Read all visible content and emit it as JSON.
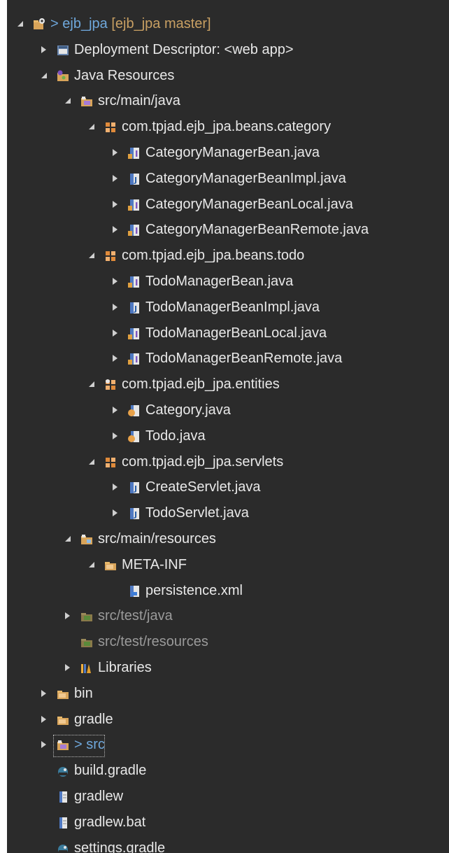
{
  "colors": {
    "background": "#2b2b2b",
    "text": "#e8e8e8",
    "muted_text": "#9a9a9a",
    "decoration": "#c9a063",
    "link": "#6fa8dc"
  },
  "tree": [
    {
      "id": "r0",
      "depth": 0,
      "state": "expanded",
      "icon": "project-icon",
      "prefix": "> ",
      "label": "ejb_jpa",
      "decoration": " [ejb_jpa master]",
      "style": "link"
    },
    {
      "id": "r1",
      "depth": 1,
      "state": "collapsed",
      "icon": "deployment-descriptor-icon",
      "label": "Deployment Descriptor: <web app>"
    },
    {
      "id": "r2",
      "depth": 1,
      "state": "expanded",
      "icon": "java-resources-icon",
      "label": "Java Resources"
    },
    {
      "id": "r3",
      "depth": 2,
      "state": "expanded",
      "icon": "source-folder-icon",
      "label": "src/main/java"
    },
    {
      "id": "r4",
      "depth": 3,
      "state": "expanded",
      "icon": "package-icon",
      "label": "com.tpjad.ejb_jpa.beans.category"
    },
    {
      "id": "r5",
      "depth": 4,
      "state": "collapsed",
      "icon": "java-interface-icon",
      "label": "CategoryManagerBean.java"
    },
    {
      "id": "r6",
      "depth": 4,
      "state": "collapsed",
      "icon": "java-class-icon",
      "label": "CategoryManagerBeanImpl.java"
    },
    {
      "id": "r7",
      "depth": 4,
      "state": "collapsed",
      "icon": "java-interface-icon",
      "label": "CategoryManagerBeanLocal.java"
    },
    {
      "id": "r8",
      "depth": 4,
      "state": "collapsed",
      "icon": "java-interface-icon",
      "label": "CategoryManagerBeanRemote.java"
    },
    {
      "id": "r9",
      "depth": 3,
      "state": "expanded",
      "icon": "package-icon",
      "label": "com.tpjad.ejb_jpa.beans.todo"
    },
    {
      "id": "r10",
      "depth": 4,
      "state": "collapsed",
      "icon": "java-interface-icon",
      "label": "TodoManagerBean.java"
    },
    {
      "id": "r11",
      "depth": 4,
      "state": "collapsed",
      "icon": "java-class-icon",
      "label": "TodoManagerBeanImpl.java"
    },
    {
      "id": "r12",
      "depth": 4,
      "state": "collapsed",
      "icon": "java-interface-icon",
      "label": "TodoManagerBeanLocal.java"
    },
    {
      "id": "r13",
      "depth": 4,
      "state": "collapsed",
      "icon": "java-interface-icon",
      "label": "TodoManagerBeanRemote.java"
    },
    {
      "id": "r14",
      "depth": 3,
      "state": "expanded",
      "icon": "entity-package-icon",
      "label": "com.tpjad.ejb_jpa.entities"
    },
    {
      "id": "r15",
      "depth": 4,
      "state": "collapsed",
      "icon": "entity-class-icon",
      "label": "Category.java"
    },
    {
      "id": "r16",
      "depth": 4,
      "state": "collapsed",
      "icon": "entity-class-icon",
      "label": "Todo.java"
    },
    {
      "id": "r17",
      "depth": 3,
      "state": "expanded",
      "icon": "package-icon",
      "label": "com.tpjad.ejb_jpa.servlets"
    },
    {
      "id": "r18",
      "depth": 4,
      "state": "collapsed",
      "icon": "java-class-icon",
      "label": "CreateServlet.java"
    },
    {
      "id": "r19",
      "depth": 4,
      "state": "collapsed",
      "icon": "java-class-icon",
      "label": "TodoServlet.java"
    },
    {
      "id": "r20",
      "depth": 2,
      "state": "expanded",
      "icon": "resource-folder-icon",
      "label": "src/main/resources"
    },
    {
      "id": "r21",
      "depth": 3,
      "state": "expanded",
      "icon": "folder-icon",
      "label": "META-INF"
    },
    {
      "id": "r22",
      "depth": 4,
      "state": "leaf",
      "icon": "xml-file-icon",
      "label": "persistence.xml"
    },
    {
      "id": "r23",
      "depth": 2,
      "state": "collapsed",
      "icon": "test-folder-icon",
      "label": "src/test/java",
      "style": "muted"
    },
    {
      "id": "r24",
      "depth": 2,
      "state": "leaf",
      "icon": "test-folder-icon",
      "label": "src/test/resources",
      "style": "muted"
    },
    {
      "id": "r25",
      "depth": 2,
      "state": "collapsed",
      "icon": "libraries-icon",
      "label": "Libraries"
    },
    {
      "id": "r26",
      "depth": 1,
      "state": "collapsed",
      "icon": "folder-icon",
      "label": "bin"
    },
    {
      "id": "r27",
      "depth": 1,
      "state": "collapsed",
      "icon": "folder-icon",
      "label": "gradle"
    },
    {
      "id": "r28",
      "depth": 1,
      "state": "collapsed",
      "icon": "source-folder-icon",
      "prefix": "> ",
      "label": "src",
      "style": "link",
      "selected": true
    },
    {
      "id": "r29",
      "depth": 1,
      "state": "leaf",
      "icon": "gradle-file-icon",
      "label": "build.gradle"
    },
    {
      "id": "r30",
      "depth": 1,
      "state": "leaf",
      "icon": "file-icon",
      "label": "gradlew"
    },
    {
      "id": "r31",
      "depth": 1,
      "state": "leaf",
      "icon": "file-icon",
      "label": "gradlew.bat"
    },
    {
      "id": "r32",
      "depth": 1,
      "state": "leaf",
      "icon": "gradle-file-icon",
      "label": "settings.gradle"
    }
  ]
}
